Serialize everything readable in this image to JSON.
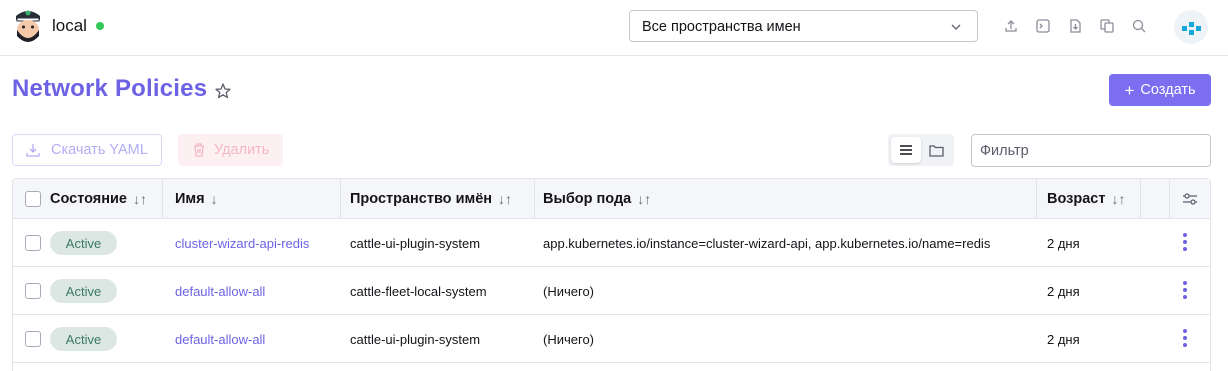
{
  "header": {
    "cluster_name": "local",
    "namespace_select": "Все пространства имен",
    "icons": [
      "upload-icon",
      "terminal-icon",
      "download-icon",
      "copy-icon",
      "search-icon"
    ]
  },
  "page": {
    "title": "Network Policies",
    "create_label": "Создать"
  },
  "actions": {
    "download_yaml": "Скачать YAML",
    "delete": "Удалить",
    "filter_placeholder": "Фильтр"
  },
  "table": {
    "columns": [
      "Состояние",
      "Имя",
      "Пространство имён",
      "Выбор пода",
      "Возраст"
    ],
    "rows": [
      {
        "state": "Active",
        "name": "cluster-wizard-api-redis",
        "namespace": "cattle-ui-plugin-system",
        "pod_selector": "app.kubernetes.io/instance=cluster-wizard-api, app.kubernetes.io/name=redis",
        "age": "2 дня"
      },
      {
        "state": "Active",
        "name": "default-allow-all",
        "namespace": "cattle-fleet-local-system",
        "pod_selector": "(Ничего)",
        "age": "2 дня"
      },
      {
        "state": "Active",
        "name": "default-allow-all",
        "namespace": "cattle-ui-plugin-system",
        "pod_selector": "(Ничего)",
        "age": "2 дня"
      }
    ]
  },
  "colors": {
    "accent": "#6e62e4",
    "primary_button": "#7b6ef0",
    "status_online": "#34c759",
    "badge_bg": "#dce7e3",
    "badge_text": "#3b7a62"
  }
}
